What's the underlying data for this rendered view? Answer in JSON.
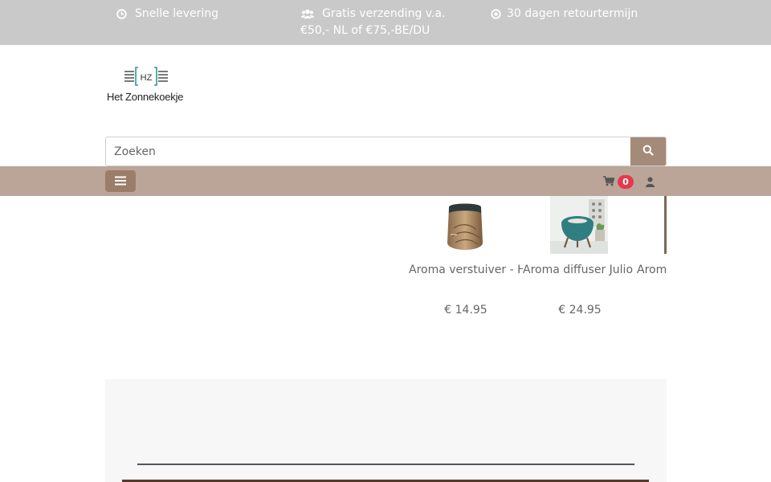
{
  "topbar": {
    "usps": [
      {
        "icon": "clock-icon",
        "text": "Snelle levering"
      },
      {
        "icon": "users-icon",
        "line1": "Gratis verzending v.a.",
        "line2": "€50,- NL of €75,-BE/DU"
      },
      {
        "icon": "dot-circle-icon",
        "text": "30 dagen retourtermijn"
      }
    ]
  },
  "brand": {
    "logo_letters": "HZ",
    "name": "Het Zonnekoekje"
  },
  "search": {
    "placeholder": "Zoeken",
    "icon": "search-icon"
  },
  "navbar": {
    "menu_icon": "hamburger-icon",
    "cart_icon": "cart-icon",
    "cart_count": "0",
    "user_icon": "user-icon"
  },
  "products": [
    {
      "name": "Aroma verstuiver - Hout",
      "price": "€ 14.95"
    },
    {
      "name": "Aroma diffuser Julio",
      "price": "€ 24.95"
    },
    {
      "name": "Aroma",
      "price": ""
    }
  ],
  "colors": {
    "topbar": "#c9c9c9",
    "navbar": "#bba598",
    "accent": "#a48a78",
    "badge": "#e4394d"
  }
}
